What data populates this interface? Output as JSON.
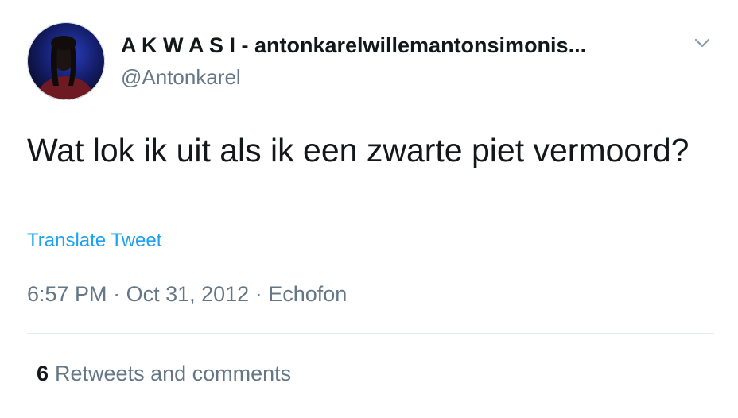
{
  "author": {
    "display_name": "A K W A S I - antonkarelwillemantonsimonis...",
    "handle": "@Antonkarel",
    "avatar_icon": "profile-photo",
    "menu_icon": "chevron-down-icon"
  },
  "tweet": {
    "text": "Wat lok ik uit als ik een zwarte piet vermoord?",
    "translate_label": "Translate Tweet",
    "time": "6:57 PM",
    "separator": "·",
    "date": "Oct 31, 2012",
    "source": "Echofon"
  },
  "engagement": {
    "count": "6",
    "label": "Retweets and comments"
  },
  "colors": {
    "text": "#14171a",
    "secondary": "#657786",
    "link": "#1da1f2",
    "divider": "#e6ecf0"
  }
}
